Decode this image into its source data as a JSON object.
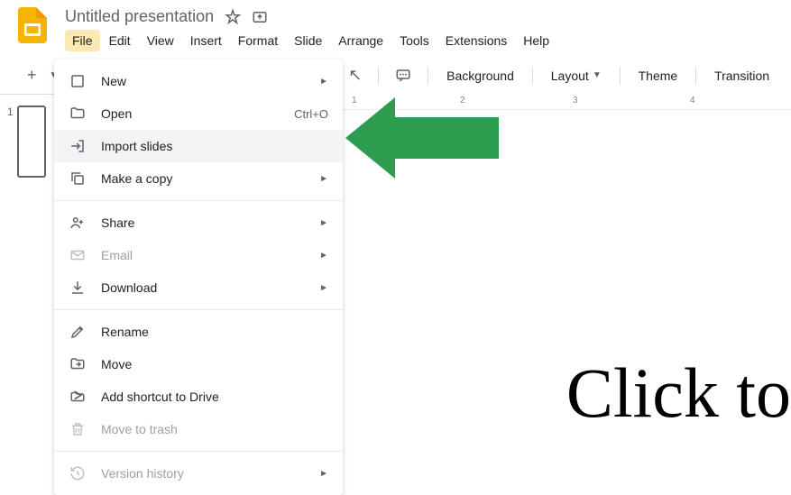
{
  "header": {
    "title": "Untitled presentation"
  },
  "menubar": {
    "items": [
      "File",
      "Edit",
      "View",
      "Insert",
      "Format",
      "Slide",
      "Arrange",
      "Tools",
      "Extensions",
      "Help"
    ],
    "active_index": 0
  },
  "toolbar": {
    "background": "Background",
    "layout": "Layout",
    "theme": "Theme",
    "transition": "Transition"
  },
  "slide_panel": {
    "current_num": "1"
  },
  "file_menu": {
    "items": [
      {
        "label": "New",
        "icon": "blank",
        "submenu": true
      },
      {
        "label": "Open",
        "icon": "folder",
        "shortcut": "Ctrl+O"
      },
      {
        "label": "Import slides",
        "icon": "import",
        "highlighted": true
      },
      {
        "label": "Make a copy",
        "icon": "copy",
        "submenu": true
      },
      {
        "divider": true
      },
      {
        "label": "Share",
        "icon": "share",
        "submenu": true
      },
      {
        "label": "Email",
        "icon": "email",
        "submenu": true,
        "disabled": true
      },
      {
        "label": "Download",
        "icon": "download",
        "submenu": true
      },
      {
        "divider": true
      },
      {
        "label": "Rename",
        "icon": "rename"
      },
      {
        "label": "Move",
        "icon": "move"
      },
      {
        "label": "Add shortcut to Drive",
        "icon": "shortcut"
      },
      {
        "label": "Move to trash",
        "icon": "trash",
        "disabled": true
      },
      {
        "divider": true
      },
      {
        "label": "Version history",
        "icon": "history",
        "submenu": true,
        "disabled": true
      }
    ]
  },
  "ruler": {
    "marks": [
      {
        "label": "1",
        "pos": 10
      },
      {
        "label": "2",
        "pos": 130
      },
      {
        "label": "3",
        "pos": 255
      },
      {
        "label": "4",
        "pos": 385
      }
    ]
  },
  "annotation": {
    "text": "Click to"
  }
}
